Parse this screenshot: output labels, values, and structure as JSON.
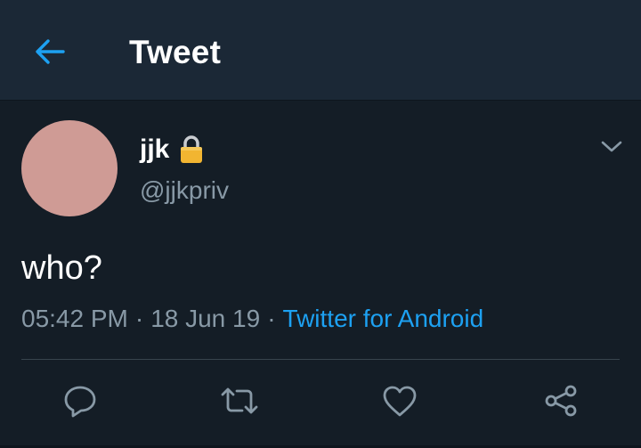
{
  "header": {
    "title": "Tweet",
    "back_icon": "arrow-left-icon"
  },
  "tweet": {
    "author": {
      "display_name": "jjk",
      "handle": "@jjkpriv",
      "protected_icon": "lock-icon",
      "avatar_color": "#cf9b95"
    },
    "text": "who?",
    "time": "05:42 PM",
    "separator": "·",
    "date": "18 Jun 19",
    "source": "Twitter for Android",
    "menu_icon": "chevron-down-icon"
  },
  "actions": [
    {
      "name": "reply",
      "icon": "reply-icon"
    },
    {
      "name": "retweet",
      "icon": "retweet-icon"
    },
    {
      "name": "like",
      "icon": "heart-icon"
    },
    {
      "name": "share",
      "icon": "share-icon"
    }
  ],
  "colors": {
    "background": "#141d26",
    "header_background": "#1b2836",
    "accent": "#1da1f2",
    "secondary_text": "#8899a6",
    "divider": "#38444d"
  }
}
